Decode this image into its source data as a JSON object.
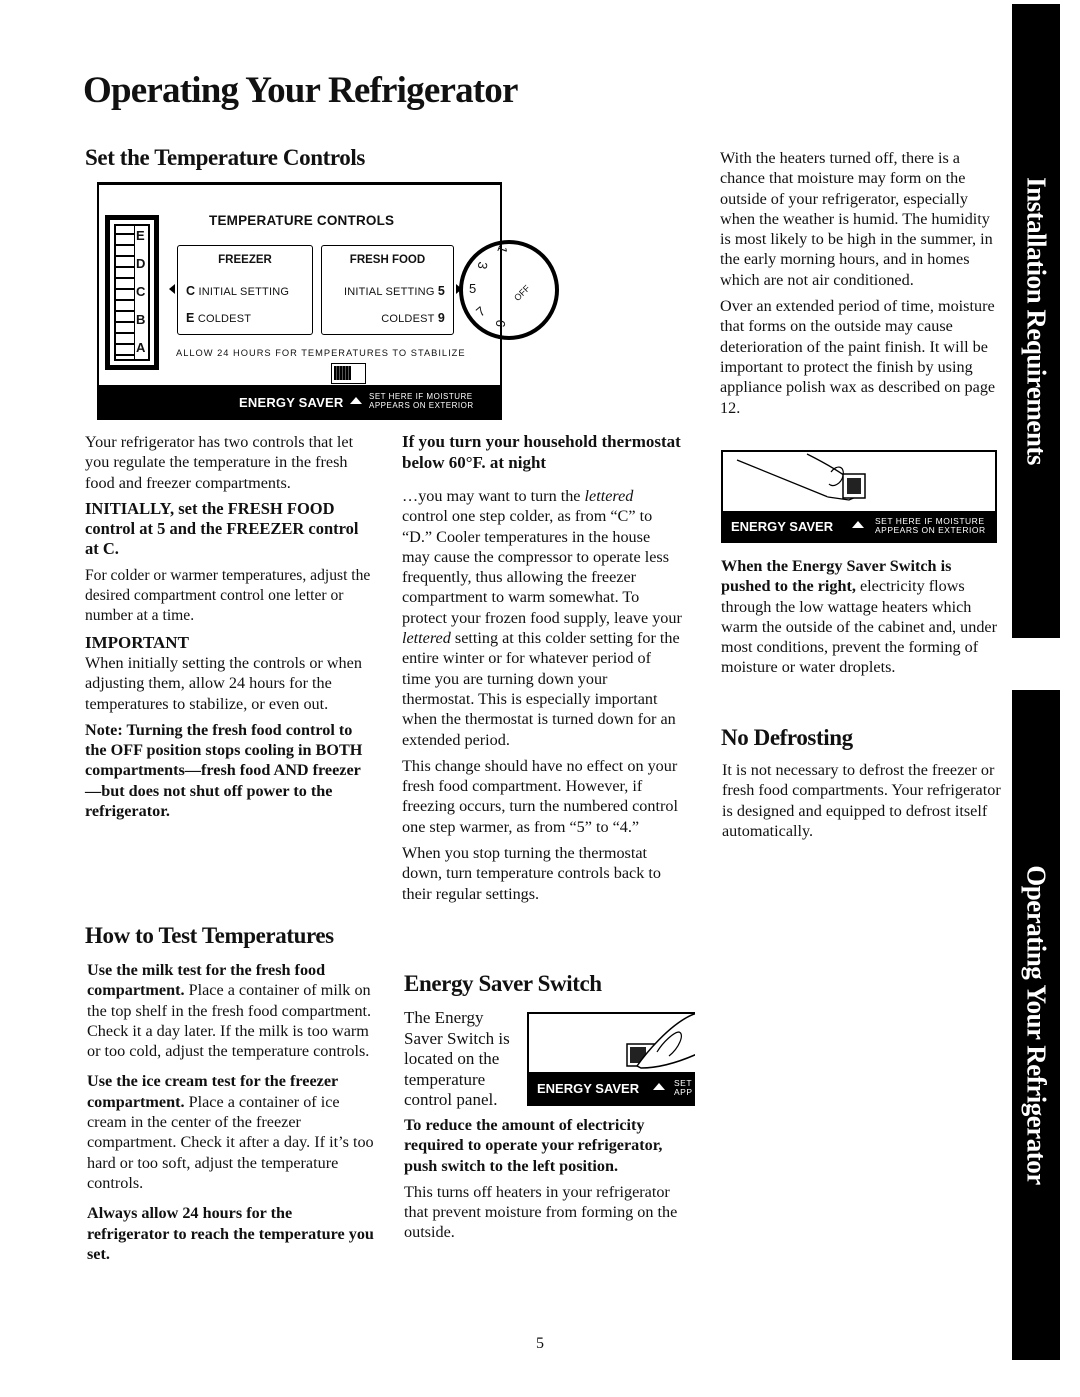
{
  "page": {
    "title": "Operating Your Refrigerator",
    "page_number": "5"
  },
  "side_tabs": [
    {
      "label": "Installation Requirements"
    },
    {
      "label": "Operating Your Refrigerator"
    }
  ],
  "set_controls": {
    "heading": "Set the Temperature Controls",
    "panel": {
      "title": "TEMPERATURE CONTROLS",
      "slider_letters": [
        "E",
        "D",
        "C",
        "B",
        "A"
      ],
      "freezer": {
        "title": "FREEZER",
        "row1_key": "C",
        "row1_label": "INITIAL SETTING",
        "row2_key": "E",
        "row2_label": "COLDEST"
      },
      "fresh_food": {
        "title": "FRESH FOOD",
        "row1_label": "INITIAL SETTING",
        "row1_key": "5",
        "row2_label": "COLDEST",
        "row2_key": "9"
      },
      "dial_labels": [
        "1",
        "3",
        "5",
        "7",
        "9",
        "OFF"
      ],
      "allow_note": "ALLOW 24 HOURS FOR TEMPERATURES TO STABILIZE",
      "energy_saver_label": "ENERGY SAVER",
      "energy_saver_note_line1": "SET HERE IF MOISTURE",
      "energy_saver_note_line2": "APPEARS ON EXTERIOR"
    },
    "intro": "Your refrigerator has two controls that let you regulate the temperature in the fresh food and freezer compartments.",
    "initially": "INITIALLY, set the FRESH FOOD control at 5 and the FREEZER control at C.",
    "colder_warmer": "For colder or warmer temperatures, adjust the desired compartment control one letter or number at a time.",
    "important_heading": "IMPORTANT",
    "important_text": "When initially setting the controls or when adjusting them, allow 24 hours for the temperatures to stabilize, or even out.",
    "note": "Note: Turning the fresh food control to the OFF position stops cooling in BOTH compartments—fresh food AND freezer—but does not shut off power to the refrigerator."
  },
  "test_temps": {
    "heading": "How to Test Temperatures",
    "milk_bold": "Use the milk test for the fresh food compartment.",
    "milk_text": " Place a container of milk on the top shelf in the fresh food compartment. Check it a day later. If the milk is too warm or too cold, adjust the temperature controls.",
    "ice_bold": "Use the ice cream test for the freezer compartment.",
    "ice_text": " Place a container of ice cream in the center of the freezer compartment. Check it after a day. If it’s too hard or too soft, adjust the temperature controls.",
    "always": "Always allow 24 hours for the refrigerator to reach the temperature you set."
  },
  "thermostat": {
    "heading": "If you turn your household thermostat below 60°F. at night",
    "p1_a": "…you may want to turn the ",
    "p1_i1": "lettered",
    "p1_b": " control one step colder, as from “C” to “D.” Cooler temperatures in the house may cause the compressor to operate less frequently, thus allowing the freezer compartment to warm somewhat. To protect your frozen food supply, leave your ",
    "p1_i2": "lettered",
    "p1_c": " setting at this colder setting for the entire winter or for whatever period of time you are turning down your thermostat. This is especially important when the thermostat is turned down for an extended period.",
    "p2": "This change should have no effect on your fresh food compartment. However, if freezing occurs, turn the numbered control one step warmer, as from “5” to “4.”",
    "p3": "When you stop turning the thermostat down, turn temperature controls back to their regular settings."
  },
  "energy_saver": {
    "heading": "Energy Saver Switch",
    "location_text": "The Energy Saver Switch is located on the temperature control panel.",
    "illustration_label": "ENERGY SAVER",
    "illustration_note_cut1": "SET",
    "illustration_note_cut2": "APP",
    "reduce_bold": "To reduce the amount of electricity required to operate your refrigerator, push switch to the left position.",
    "heaters_off": "This turns off heaters in your refrigerator that prevent moisture from forming on the outside."
  },
  "right_column": {
    "p1": "With the heaters turned off, there is a chance that moisture may form on the outside of your refrigerator, especially when the weather is humid. The humidity is most likely to be high in the summer, in the early morning hours, and in homes which are not air conditioned.",
    "p2": "Over an extended period of time, moisture that forms on the outside may cause deterioration of the paint finish. It will be important to protect the finish by using appliance polish wax as described on page 12.",
    "illustration_label": "ENERGY SAVER",
    "illustration_note_line1": "SET HERE IF MOISTURE",
    "illustration_note_line2": "APPEARS ON EXTERIOR",
    "pushed_right_bold": "When the Energy Saver Switch is pushed to the right,",
    "pushed_right_text": " electricity flows through the low wattage heaters which warm the outside of the cabinet and, under most conditions, prevent the forming of moisture or water droplets.",
    "no_defrost_heading": "No Defrosting",
    "no_defrost_text": "It is not necessary to defrost the freezer or fresh food compartments. Your refrigerator is designed and equipped to defrost itself automatically."
  }
}
